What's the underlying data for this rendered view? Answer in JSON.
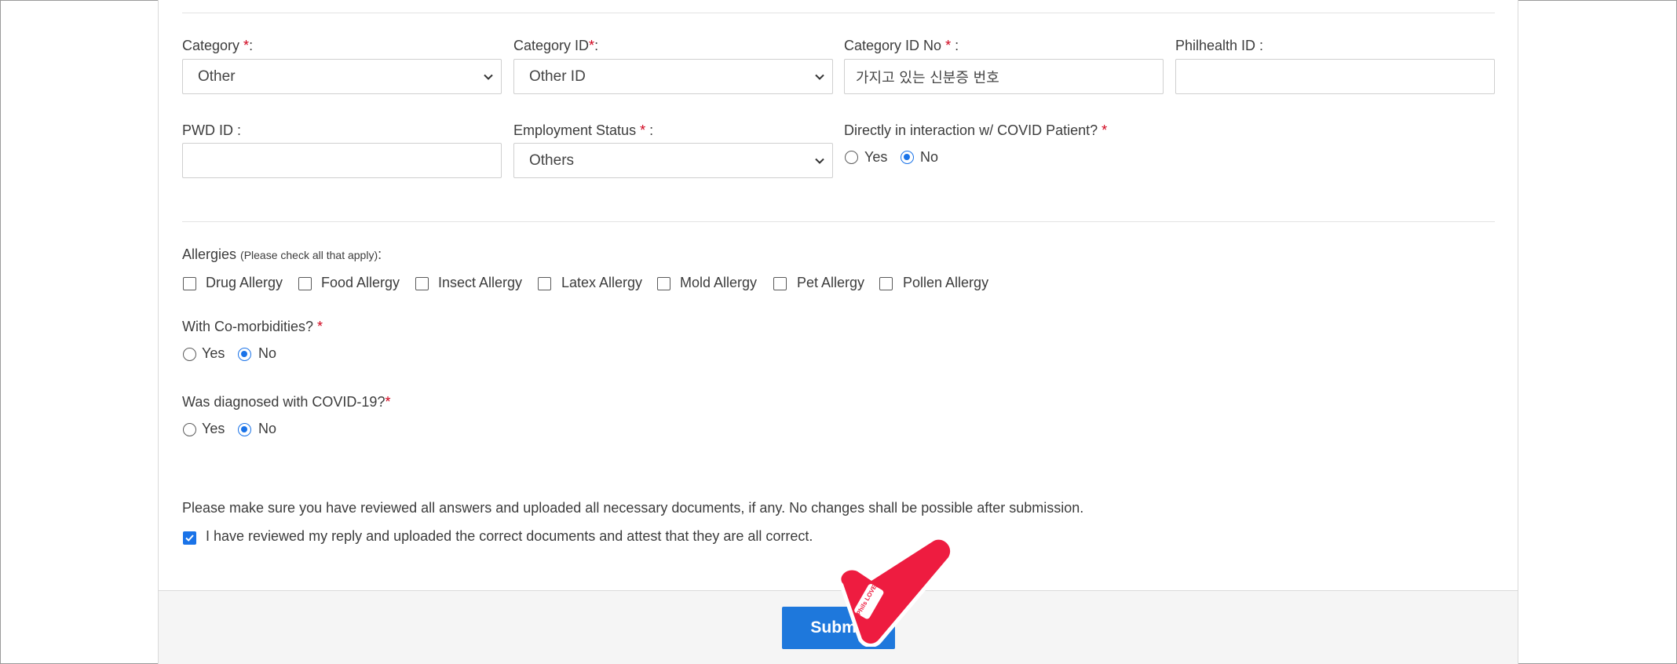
{
  "form": {
    "category": {
      "label": "Category ",
      "required": "*",
      "suffix": ":",
      "value": "Other"
    },
    "category_id": {
      "label": "Category ID",
      "required": "*",
      "suffix": ":",
      "value": "Other ID"
    },
    "category_id_no": {
      "label": "Category ID No ",
      "required": "*",
      "suffix": " :",
      "value": "가지고 있는 신분증 번호"
    },
    "philhealth_id": {
      "label": "Philhealth ID :",
      "value": ""
    },
    "pwd_id": {
      "label": "PWD ID :",
      "value": ""
    },
    "employment_status": {
      "label": "Employment Status ",
      "required": "*",
      "suffix": " :",
      "value": "Others"
    },
    "covid_interaction": {
      "label": "Directly in interaction w/ COVID Patient? ",
      "required": "*",
      "yes": "Yes",
      "no": "No",
      "selected": "No"
    },
    "allergies": {
      "label": "Allergies ",
      "hint": "(Please check all that apply)",
      "suffix": ":",
      "options": [
        "Drug Allergy",
        "Food Allergy",
        "Insect Allergy",
        "Latex Allergy",
        "Mold Allergy",
        "Pet Allergy",
        "Pollen Allergy"
      ]
    },
    "comorbidities": {
      "label": "With Co-morbidities? ",
      "required": "*",
      "yes": "Yes",
      "no": "No",
      "selected": "No"
    },
    "diagnosed_covid": {
      "label": "Was diagnosed with COVID-19?",
      "required": "*",
      "yes": "Yes",
      "no": "No",
      "selected": "No"
    },
    "review_notice": "Please make sure you have reviewed all answers and uploaded all necessary documents, if any. No changes shall be possible after submission.",
    "attest": {
      "label": "I have reviewed my reply and uploaded the correct documents and attest that they are all correct.",
      "checked": true
    },
    "submit_label": "Submit",
    "sticker_text": "Phils LOVE"
  },
  "colors": {
    "accent": "#1e78dc",
    "required": "#d0021b",
    "sticker": "#ee1c40"
  }
}
